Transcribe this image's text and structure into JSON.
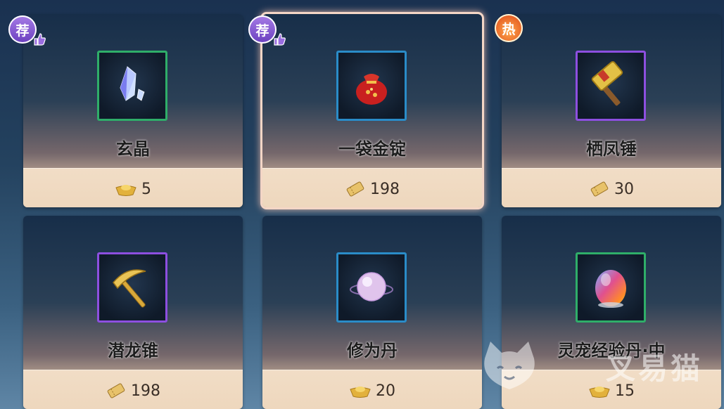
{
  "items": [
    {
      "name": "玄晶",
      "price": "5",
      "currency_icon": "ingot-icon",
      "badge": "荐",
      "badge_type": "recommend",
      "frame": "green",
      "icon": "crystal-icon"
    },
    {
      "name": "一袋金锭",
      "price": "198",
      "currency_icon": "ticket-icon",
      "badge": "荐",
      "badge_type": "recommend",
      "frame": "blue",
      "icon": "red-bag-icon",
      "selected": true
    },
    {
      "name": "栖凤锤",
      "price": "30",
      "currency_icon": "ticket-icon",
      "badge": "热",
      "badge_type": "hot",
      "frame": "purple",
      "icon": "hammer-icon"
    },
    {
      "name": "潜龙锥",
      "price": "198",
      "currency_icon": "ticket-icon",
      "frame": "purple",
      "icon": "pickaxe-icon"
    },
    {
      "name": "修为丹",
      "price": "20",
      "currency_icon": "ingot-icon",
      "frame": "blue",
      "icon": "pearl-pill-icon"
    },
    {
      "name": "灵宠经验丹·中",
      "price": "15",
      "currency_icon": "ingot-icon",
      "frame": "green",
      "icon": "rainbow-pill-icon"
    }
  ],
  "watermark": "叉易猫",
  "colors": {
    "frame_green": "#2fae69",
    "frame_blue": "#2a8cc8",
    "frame_purple": "#8d4fe0",
    "badge_recommend": "#7a4ed0",
    "badge_hot": "#e8642a"
  }
}
